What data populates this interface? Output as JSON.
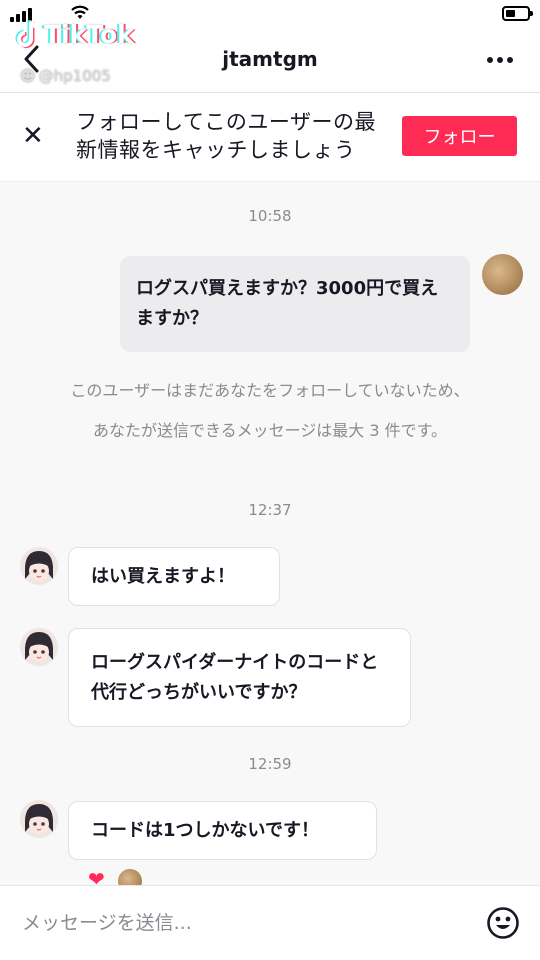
{
  "watermark": {
    "brand": "TikTok",
    "handle": "@hp1005"
  },
  "status": {
    "battery_level": 0.45
  },
  "header": {
    "title": "jtamtgm"
  },
  "banner": {
    "text": "フォローしてこのユーザーの最新情報をキャッチしましょう",
    "follow_label": "フォロー"
  },
  "chat": {
    "time_1": "10:58",
    "sent_message": "ログスパ買えますか？3000円で買えますか？",
    "notice": "このユーザーはまだあなたをフォローしていないため、あなたが送信できるメッセージは最大 3 件です。",
    "time_2": "12:37",
    "reply_1": "はい買えますよ！",
    "reply_2": "ローグスパイダーナイトのコードと代行どっちがいいですか？",
    "time_3": "12:59",
    "reply_3": "コードは1つしかないです！"
  },
  "input": {
    "placeholder": "メッセージを送信..."
  },
  "colors": {
    "accent": "#fe2c55",
    "heart": "#fe2c55"
  }
}
